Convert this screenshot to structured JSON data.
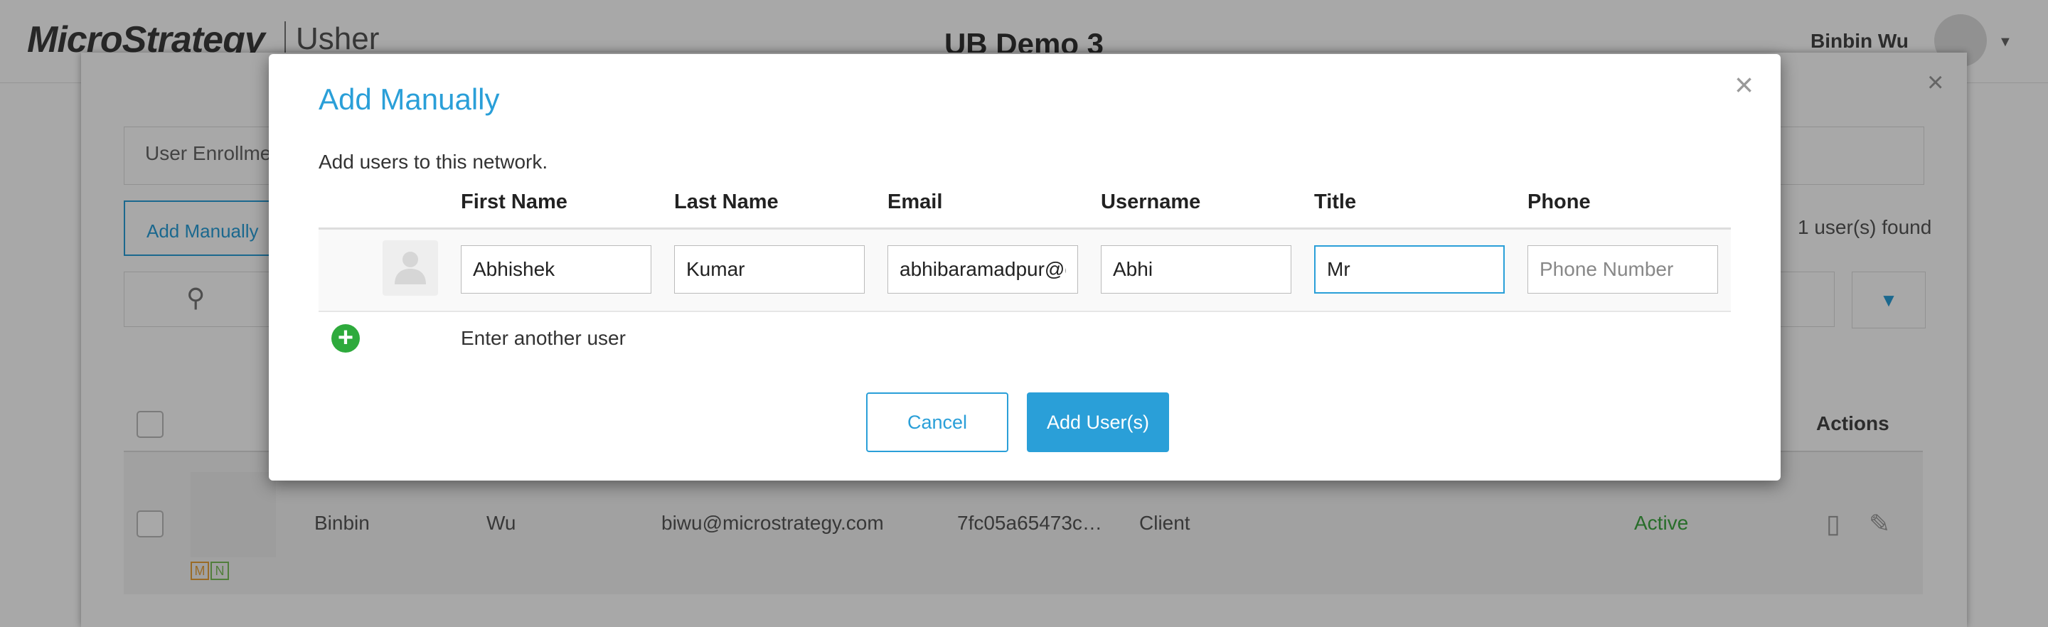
{
  "app": {
    "logo": "MicroStrategy",
    "product": "Usher",
    "title": "UB Demo 3",
    "user": "Binbin Wu"
  },
  "background": {
    "tab_label": "User Enrollment",
    "add_manually_label": "Add Manually",
    "found_text": "1 user(s) found",
    "actions_header": "Actions",
    "row": {
      "first_name": "Binbin",
      "last_name": "Wu",
      "email": "biwu@microstrategy.com",
      "username": "7fc05a65473c…",
      "title": "Client",
      "status": "Active",
      "badges": [
        "M",
        "N"
      ]
    },
    "colors": {
      "accent": "#2a9fd8",
      "active": "#3ea640",
      "badge_m": "#e8a33a",
      "badge_n": "#7bbf5a"
    }
  },
  "modal": {
    "title": "Add Manually",
    "close": "×",
    "description": "Add users to this network.",
    "columns": [
      "First Name",
      "Last Name",
      "Email",
      "Username",
      "Title",
      "Phone"
    ],
    "entry": {
      "first_name": "Abhishek",
      "last_name": "Kumar",
      "email": "abhibaramadpur@g",
      "username": "Abhi",
      "title": "Mr",
      "phone": "",
      "phone_placeholder": "Phone Number"
    },
    "add_another_label": "Enter another user",
    "cancel_label": "Cancel",
    "submit_label": "Add User(s)"
  },
  "icons": [
    "close-icon",
    "search-icon",
    "filter-icon",
    "user-placeholder-icon",
    "add-circle-icon",
    "mobile-icon",
    "edit-icon"
  ]
}
